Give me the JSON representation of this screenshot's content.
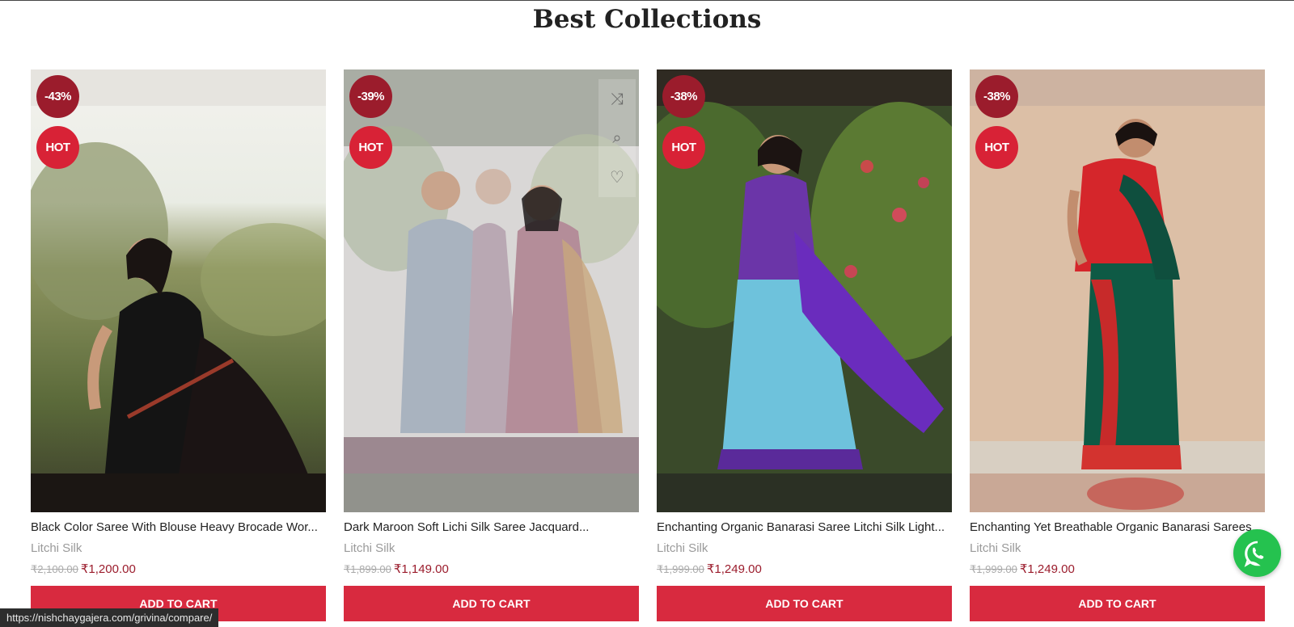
{
  "section": {
    "title": "Best Collections"
  },
  "products": [
    {
      "name": "Black Color Saree With Blouse Heavy Brocade Wor...",
      "category": "Litchi Silk",
      "old_price": "₹2,100.00",
      "new_price": "₹1,200.00",
      "discount": "-43%",
      "tag": "HOT",
      "cta": "ADD TO CART"
    },
    {
      "name": "Dark Maroon Soft Lichi Silk Saree Jacquard...",
      "category": "Litchi Silk",
      "old_price": "₹1,899.00",
      "new_price": "₹1,149.00",
      "discount": "-39%",
      "tag": "HOT",
      "cta": "ADD TO CART"
    },
    {
      "name": "Enchanting Organic Banarasi Saree Litchi Silk Light...",
      "category": "Litchi Silk",
      "old_price": "₹1,999.00",
      "new_price": "₹1,249.00",
      "discount": "-38%",
      "tag": "HOT",
      "cta": "ADD TO CART"
    },
    {
      "name": "Enchanting Yet Breathable Organic Banarasi Sarees...",
      "category": "Litchi Silk",
      "old_price": "₹1,999.00",
      "new_price": "₹1,249.00",
      "discount": "-38%",
      "tag": "HOT",
      "cta": "ADD TO CART"
    }
  ],
  "hover_actions": {
    "icons": [
      "shuffle-icon",
      "search-icon",
      "heart-icon"
    ]
  },
  "status_bar": {
    "url": "https://nishchaygajera.com/grivina/compare/"
  },
  "colors": {
    "accent": "#d82a3f",
    "sale_badge": "#9b1c2c",
    "whatsapp": "#25c24f"
  }
}
